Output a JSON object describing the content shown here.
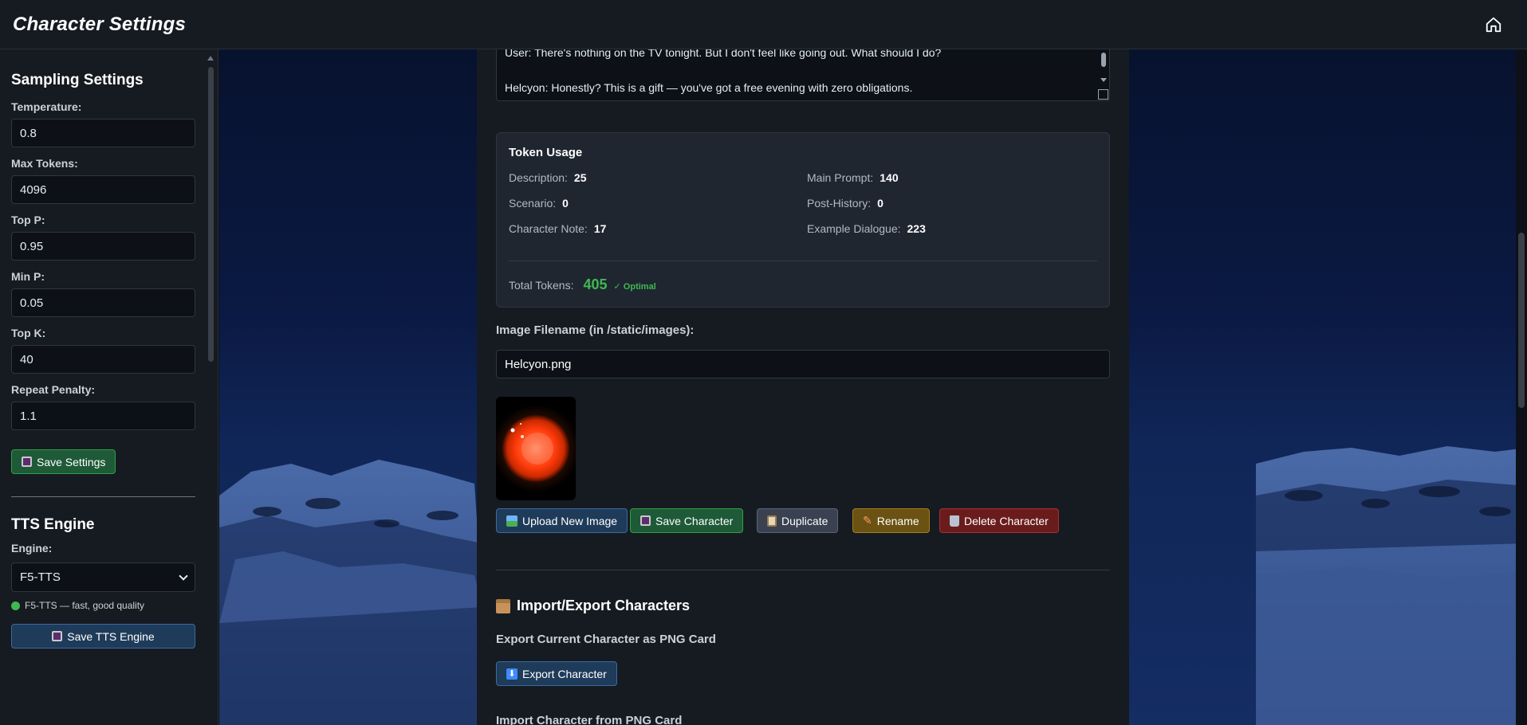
{
  "header": {
    "title": "Character Settings",
    "home_icon": "home-icon"
  },
  "sidebar": {
    "sampling_title": "Sampling Settings",
    "fields": [
      {
        "label": "Temperature:",
        "value": "0.8"
      },
      {
        "label": "Max Tokens:",
        "value": "4096"
      },
      {
        "label": "Top P:",
        "value": "0.95"
      },
      {
        "label": "Min P:",
        "value": "0.05"
      },
      {
        "label": "Top K:",
        "value": "40"
      },
      {
        "label": "Repeat Penalty:",
        "value": "1.1"
      }
    ],
    "save_settings_label": "Save Settings",
    "tts_title": "TTS Engine",
    "engine_label": "Engine:",
    "engine_selected": "F5-TTS",
    "engine_note": "F5-TTS — fast, good quality",
    "save_tts_label": "Save TTS Engine"
  },
  "main": {
    "example_dialogue": {
      "line1": "User: There's nothing on the TV tonight. But I don't feel like going out. What should I do?",
      "line2": "Helcyon: Honestly? This is a gift — you've got a free evening with zero obligations."
    },
    "token_usage": {
      "title": "Token Usage",
      "items": [
        {
          "label": "Description:",
          "value": "25"
        },
        {
          "label": "Main Prompt:",
          "value": "140"
        },
        {
          "label": "Scenario:",
          "value": "0"
        },
        {
          "label": "Post-History:",
          "value": "0"
        },
        {
          "label": "Character Note:",
          "value": "17"
        },
        {
          "label": "Example Dialogue:",
          "value": "223"
        }
      ],
      "total_label": "Total Tokens:",
      "total_value": "405",
      "status": "✓ Optimal",
      "status_color": "#3fb950"
    },
    "image_label": "Image Filename (in /static/images):",
    "image_value": "Helcyon.png",
    "buttons": {
      "upload": "Upload New Image",
      "save": "Save Character",
      "duplicate": "Duplicate",
      "rename": "Rename",
      "delete": "Delete Character"
    },
    "import_export": {
      "title": "Import/Export Characters",
      "export_sub": "Export Current Character as PNG Card",
      "export_btn": "Export Character",
      "import_sub": "Import Character from PNG Card"
    }
  },
  "colors": {
    "accent_green": "#2ea043",
    "accent_blue": "#3b6aa0",
    "danger": "#a33030",
    "warning": "#a07e22"
  }
}
